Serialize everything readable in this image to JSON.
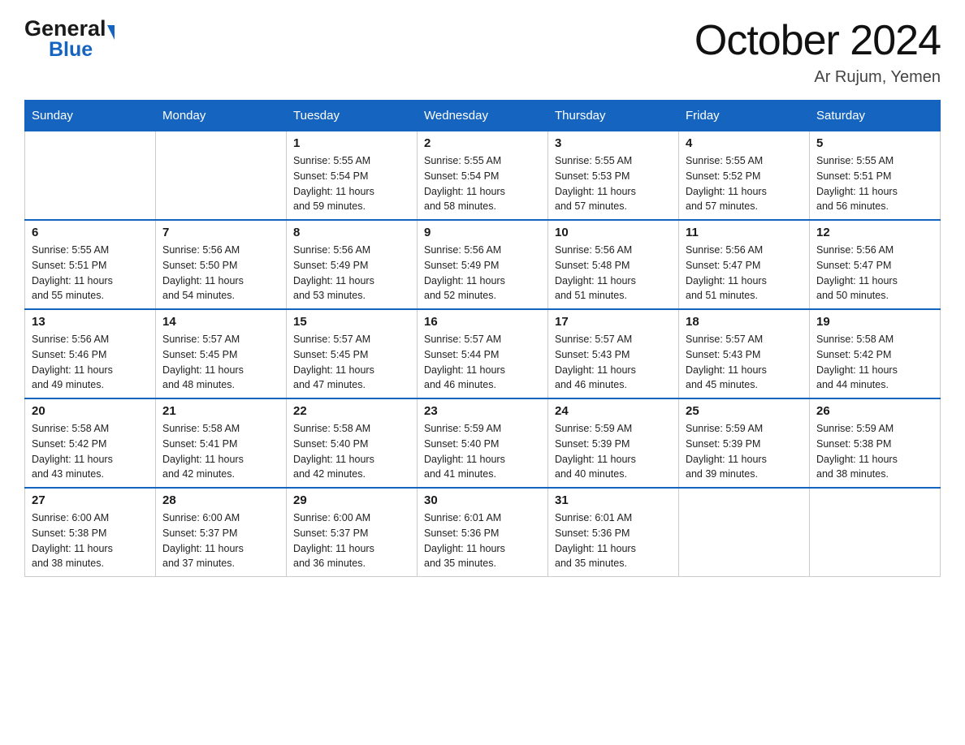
{
  "header": {
    "month_title": "October 2024",
    "location": "Ar Rujum, Yemen"
  },
  "logo": {
    "line1": "General",
    "line2": "Blue"
  },
  "days_of_week": [
    "Sunday",
    "Monday",
    "Tuesday",
    "Wednesday",
    "Thursday",
    "Friday",
    "Saturday"
  ],
  "weeks": [
    [
      {
        "day": "",
        "info": ""
      },
      {
        "day": "",
        "info": ""
      },
      {
        "day": "1",
        "info": "Sunrise: 5:55 AM\nSunset: 5:54 PM\nDaylight: 11 hours\nand 59 minutes."
      },
      {
        "day": "2",
        "info": "Sunrise: 5:55 AM\nSunset: 5:54 PM\nDaylight: 11 hours\nand 58 minutes."
      },
      {
        "day": "3",
        "info": "Sunrise: 5:55 AM\nSunset: 5:53 PM\nDaylight: 11 hours\nand 57 minutes."
      },
      {
        "day": "4",
        "info": "Sunrise: 5:55 AM\nSunset: 5:52 PM\nDaylight: 11 hours\nand 57 minutes."
      },
      {
        "day": "5",
        "info": "Sunrise: 5:55 AM\nSunset: 5:51 PM\nDaylight: 11 hours\nand 56 minutes."
      }
    ],
    [
      {
        "day": "6",
        "info": "Sunrise: 5:55 AM\nSunset: 5:51 PM\nDaylight: 11 hours\nand 55 minutes."
      },
      {
        "day": "7",
        "info": "Sunrise: 5:56 AM\nSunset: 5:50 PM\nDaylight: 11 hours\nand 54 minutes."
      },
      {
        "day": "8",
        "info": "Sunrise: 5:56 AM\nSunset: 5:49 PM\nDaylight: 11 hours\nand 53 minutes."
      },
      {
        "day": "9",
        "info": "Sunrise: 5:56 AM\nSunset: 5:49 PM\nDaylight: 11 hours\nand 52 minutes."
      },
      {
        "day": "10",
        "info": "Sunrise: 5:56 AM\nSunset: 5:48 PM\nDaylight: 11 hours\nand 51 minutes."
      },
      {
        "day": "11",
        "info": "Sunrise: 5:56 AM\nSunset: 5:47 PM\nDaylight: 11 hours\nand 51 minutes."
      },
      {
        "day": "12",
        "info": "Sunrise: 5:56 AM\nSunset: 5:47 PM\nDaylight: 11 hours\nand 50 minutes."
      }
    ],
    [
      {
        "day": "13",
        "info": "Sunrise: 5:56 AM\nSunset: 5:46 PM\nDaylight: 11 hours\nand 49 minutes."
      },
      {
        "day": "14",
        "info": "Sunrise: 5:57 AM\nSunset: 5:45 PM\nDaylight: 11 hours\nand 48 minutes."
      },
      {
        "day": "15",
        "info": "Sunrise: 5:57 AM\nSunset: 5:45 PM\nDaylight: 11 hours\nand 47 minutes."
      },
      {
        "day": "16",
        "info": "Sunrise: 5:57 AM\nSunset: 5:44 PM\nDaylight: 11 hours\nand 46 minutes."
      },
      {
        "day": "17",
        "info": "Sunrise: 5:57 AM\nSunset: 5:43 PM\nDaylight: 11 hours\nand 46 minutes."
      },
      {
        "day": "18",
        "info": "Sunrise: 5:57 AM\nSunset: 5:43 PM\nDaylight: 11 hours\nand 45 minutes."
      },
      {
        "day": "19",
        "info": "Sunrise: 5:58 AM\nSunset: 5:42 PM\nDaylight: 11 hours\nand 44 minutes."
      }
    ],
    [
      {
        "day": "20",
        "info": "Sunrise: 5:58 AM\nSunset: 5:42 PM\nDaylight: 11 hours\nand 43 minutes."
      },
      {
        "day": "21",
        "info": "Sunrise: 5:58 AM\nSunset: 5:41 PM\nDaylight: 11 hours\nand 42 minutes."
      },
      {
        "day": "22",
        "info": "Sunrise: 5:58 AM\nSunset: 5:40 PM\nDaylight: 11 hours\nand 42 minutes."
      },
      {
        "day": "23",
        "info": "Sunrise: 5:59 AM\nSunset: 5:40 PM\nDaylight: 11 hours\nand 41 minutes."
      },
      {
        "day": "24",
        "info": "Sunrise: 5:59 AM\nSunset: 5:39 PM\nDaylight: 11 hours\nand 40 minutes."
      },
      {
        "day": "25",
        "info": "Sunrise: 5:59 AM\nSunset: 5:39 PM\nDaylight: 11 hours\nand 39 minutes."
      },
      {
        "day": "26",
        "info": "Sunrise: 5:59 AM\nSunset: 5:38 PM\nDaylight: 11 hours\nand 38 minutes."
      }
    ],
    [
      {
        "day": "27",
        "info": "Sunrise: 6:00 AM\nSunset: 5:38 PM\nDaylight: 11 hours\nand 38 minutes."
      },
      {
        "day": "28",
        "info": "Sunrise: 6:00 AM\nSunset: 5:37 PM\nDaylight: 11 hours\nand 37 minutes."
      },
      {
        "day": "29",
        "info": "Sunrise: 6:00 AM\nSunset: 5:37 PM\nDaylight: 11 hours\nand 36 minutes."
      },
      {
        "day": "30",
        "info": "Sunrise: 6:01 AM\nSunset: 5:36 PM\nDaylight: 11 hours\nand 35 minutes."
      },
      {
        "day": "31",
        "info": "Sunrise: 6:01 AM\nSunset: 5:36 PM\nDaylight: 11 hours\nand 35 minutes."
      },
      {
        "day": "",
        "info": ""
      },
      {
        "day": "",
        "info": ""
      }
    ]
  ]
}
